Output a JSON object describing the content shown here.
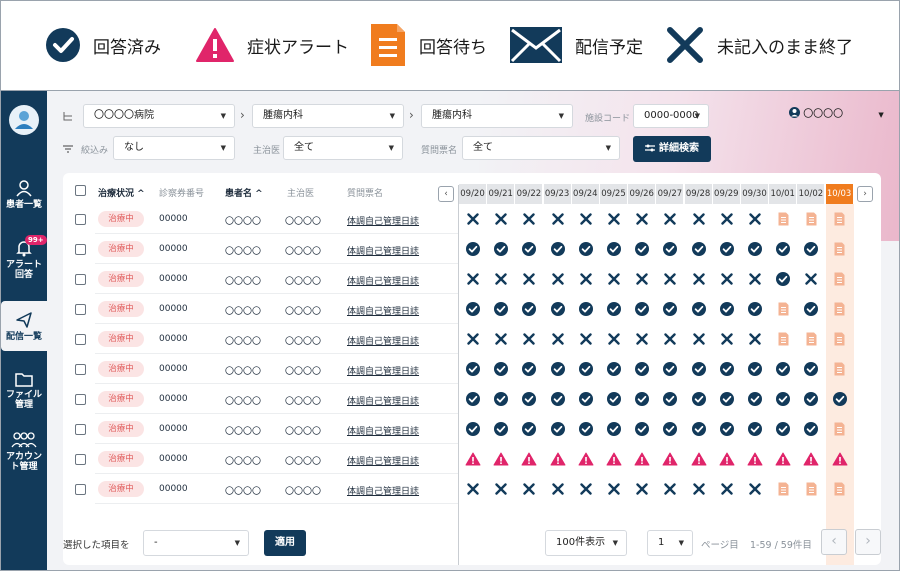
{
  "legend": [
    {
      "icon": "check-circle-icon",
      "label": "回答済み",
      "color": "#123a5a"
    },
    {
      "icon": "alert-triangle-icon",
      "label": "症状アラート",
      "color": "#e0256a"
    },
    {
      "icon": "document-icon",
      "label": "回答待ち",
      "color": "#f07c1e"
    },
    {
      "icon": "envelope-icon",
      "label": "配信予定",
      "color": "#123a5a"
    },
    {
      "icon": "x-mark-icon",
      "label": "未記入のまま終了",
      "color": "#123a5a"
    }
  ],
  "sidebar": {
    "items": [
      {
        "label": "患者一覧",
        "icon": "patients-icon"
      },
      {
        "label": "アラート\n回答",
        "icon": "bell-icon",
        "badge": "99+"
      },
      {
        "label": "配信一覧",
        "icon": "send-icon",
        "active": true
      },
      {
        "label": "ファイル\n管理",
        "icon": "folder-icon"
      },
      {
        "label": "アカウン\nト管理",
        "icon": "users-icon"
      }
    ]
  },
  "filters": {
    "hospital": "〇〇〇〇病院",
    "dept1": "腫瘍内科",
    "dept2": "腫瘍内科",
    "facility_code_label": "施設コード",
    "facility_code": "0000-0000",
    "narrow_label": "絞込み",
    "narrow_value": "なし",
    "doctor_label": "主治医",
    "doctor_value": "全て",
    "form_label": "質問票名",
    "form_value": "全て",
    "detail_search": "詳細検索",
    "user": "〇〇〇〇"
  },
  "table": {
    "headers": {
      "status": "治療状況",
      "number": "診察券番号",
      "patient": "患者名",
      "doctor": "主治医",
      "form": "質問票名"
    },
    "dates": [
      "09/20",
      "09/21",
      "09/22",
      "09/23",
      "09/24",
      "09/25",
      "09/26",
      "09/27",
      "09/28",
      "09/29",
      "09/30",
      "10/01",
      "10/02",
      "10/03"
    ],
    "today_index": 13,
    "rows": [
      {
        "status": "治療中",
        "number": "00000",
        "patient": "〇〇〇〇",
        "doctor": "〇〇〇〇",
        "form": "体調自己管理日誌",
        "cells": "XXXXXXXXXXXDDD"
      },
      {
        "status": "治療中",
        "number": "00000",
        "patient": "〇〇〇〇",
        "doctor": "〇〇〇〇",
        "form": "体調自己管理日誌",
        "cells": "CCCCCCCCCCCCCD"
      },
      {
        "status": "治療中",
        "number": "00000",
        "patient": "〇〇〇〇",
        "doctor": "〇〇〇〇",
        "form": "体調自己管理日誌",
        "cells": "XXXXXXXXXXXCXD"
      },
      {
        "status": "治療中",
        "number": "00000",
        "patient": "〇〇〇〇",
        "doctor": "〇〇〇〇",
        "form": "体調自己管理日誌",
        "cells": "CCCCCCCCCCCDCD"
      },
      {
        "status": "治療中",
        "number": "00000",
        "patient": "〇〇〇〇",
        "doctor": "〇〇〇〇",
        "form": "体調自己管理日誌",
        "cells": "XXXXXXXXXXXDDD"
      },
      {
        "status": "治療中",
        "number": "00000",
        "patient": "〇〇〇〇",
        "doctor": "〇〇〇〇",
        "form": "体調自己管理日誌",
        "cells": "CCCCCCCCCCCCCD"
      },
      {
        "status": "治療中",
        "number": "00000",
        "patient": "〇〇〇〇",
        "doctor": "〇〇〇〇",
        "form": "体調自己管理日誌",
        "cells": "CCCCCCCCCCCCCC"
      },
      {
        "status": "治療中",
        "number": "00000",
        "patient": "〇〇〇〇",
        "doctor": "〇〇〇〇",
        "form": "体調自己管理日誌",
        "cells": "CCCCCCCCCCCCCD"
      },
      {
        "status": "治療中",
        "number": "00000",
        "patient": "〇〇〇〇",
        "doctor": "〇〇〇〇",
        "form": "体調自己管理日誌",
        "cells": "AAAAAAAAAAAAAA"
      },
      {
        "status": "治療中",
        "number": "00000",
        "patient": "〇〇〇〇",
        "doctor": "〇〇〇〇",
        "form": "体調自己管理日誌",
        "cells": "XXXXXXXXXXXDDD"
      }
    ]
  },
  "footer": {
    "selected_label": "選択した項目を",
    "selected_value": "-",
    "apply": "適用",
    "per_page": "100件表示",
    "page": "1",
    "page_suffix": "ページ目",
    "range": "1-59 / 59件目"
  },
  "colors": {
    "navy": "#123a5a",
    "pink": "#e0256a",
    "orange": "#f07c1e",
    "doc": "#f4b393"
  }
}
